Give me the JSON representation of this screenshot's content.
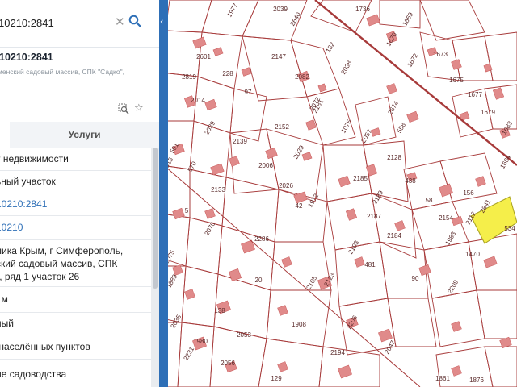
{
  "search": {
    "value": "10210:2841",
    "clear_icon": "close-icon",
    "search_icon": "search-icon"
  },
  "info": {
    "title": "10210:2841",
    "subtitle": "менский садовый массив, СПК \"Садко\","
  },
  "tabs": {
    "services_label": "Услуги"
  },
  "details": [
    {
      "text": "т недвижимости",
      "link": false
    },
    {
      "text": "ьный участок",
      "link": false
    },
    {
      "text": "10210:2841",
      "link": true
    },
    {
      "text": "10210",
      "link": true
    },
    {
      "text": "лика Крым, г Симферополь,\nский садовый массив, СПК\n\", ряд 1 участок 26",
      "link": false
    },
    {
      "text": ". м",
      "link": false
    },
    {
      "text": "ный",
      "link": false
    },
    {
      "text": " населённых пунктов",
      "link": false
    },
    {
      "text": "ие садоводства",
      "link": false
    }
  ],
  "map": {
    "plot_color": "#a73a3a",
    "building_color": "#e08a8a",
    "selected_color": "#f5ee4a",
    "labels": [
      {
        "t": "1977"
      },
      {
        "t": "2039"
      },
      {
        "t": "2640"
      },
      {
        "t": "1736"
      },
      {
        "t": "1669"
      },
      {
        "t": "2601"
      },
      {
        "t": "2147"
      },
      {
        "t": "182"
      },
      {
        "t": "2819"
      },
      {
        "t": "228"
      },
      {
        "t": "2082"
      },
      {
        "t": "2038"
      },
      {
        "t": "1670"
      },
      {
        "t": "1672"
      },
      {
        "t": "1673"
      },
      {
        "t": "2014"
      },
      {
        "t": "97"
      },
      {
        "t": "2072"
      },
      {
        "t": "2181"
      },
      {
        "t": "1675"
      },
      {
        "t": "1677"
      },
      {
        "t": "1679"
      },
      {
        "t": "2029"
      },
      {
        "t": "2152"
      },
      {
        "t": "1075"
      },
      {
        "t": "2057"
      },
      {
        "t": "558"
      },
      {
        "t": "2674"
      },
      {
        "t": "1683"
      },
      {
        "t": "2139"
      },
      {
        "t": "2015"
      },
      {
        "t": "2128"
      },
      {
        "t": "501"
      },
      {
        "t": "570"
      },
      {
        "t": "2006"
      },
      {
        "t": "2029"
      },
      {
        "t": "2185"
      },
      {
        "t": "438"
      },
      {
        "t": "2133"
      },
      {
        "t": "2026"
      },
      {
        "t": "42"
      },
      {
        "t": "58"
      },
      {
        "t": "156"
      },
      {
        "t": "1972"
      },
      {
        "t": "2189"
      },
      {
        "t": "2187"
      },
      {
        "t": "2154"
      },
      {
        "t": "2112"
      },
      {
        "t": "2841"
      },
      {
        "t": "534"
      },
      {
        "t": "5"
      },
      {
        "t": "2070"
      },
      {
        "t": "2286"
      },
      {
        "t": "2184"
      },
      {
        "t": "1983"
      },
      {
        "t": "2075"
      },
      {
        "t": "2103"
      },
      {
        "t": "1470"
      },
      {
        "t": "1889"
      },
      {
        "t": "481"
      },
      {
        "t": "90"
      },
      {
        "t": "20"
      },
      {
        "t": "2105"
      },
      {
        "t": "2123"
      },
      {
        "t": "2209"
      },
      {
        "t": "138"
      },
      {
        "t": "1908"
      },
      {
        "t": "2035"
      },
      {
        "t": "2053"
      },
      {
        "t": "2206"
      },
      {
        "t": "1980"
      },
      {
        "t": "2194"
      },
      {
        "t": "2047"
      },
      {
        "t": "2056"
      },
      {
        "t": "2231"
      },
      {
        "t": "129"
      },
      {
        "t": "1876"
      },
      {
        "t": "1861"
      },
      {
        "t": "1684"
      }
    ]
  }
}
